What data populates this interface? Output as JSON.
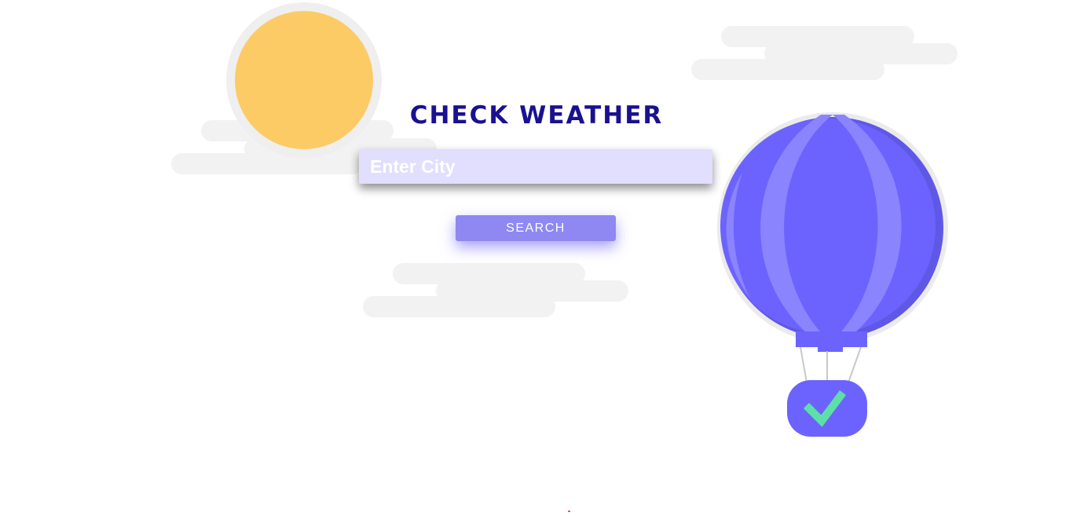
{
  "page": {
    "title": "CHECK WEATHER"
  },
  "search": {
    "placeholder": "Enter City",
    "value": "",
    "button_label": "SEARCH"
  },
  "colors": {
    "title": "#1a1190",
    "input_background": "#e1defe",
    "button_background": "#8f88f2",
    "balloon": "#6c63ff",
    "sun": "#fccb66",
    "cloud": "#f2f2f2",
    "checkmark": "#5de0a8"
  },
  "icons": {
    "sun": "sun-icon",
    "balloon": "hot-air-balloon-icon",
    "check": "checkmark-icon"
  }
}
